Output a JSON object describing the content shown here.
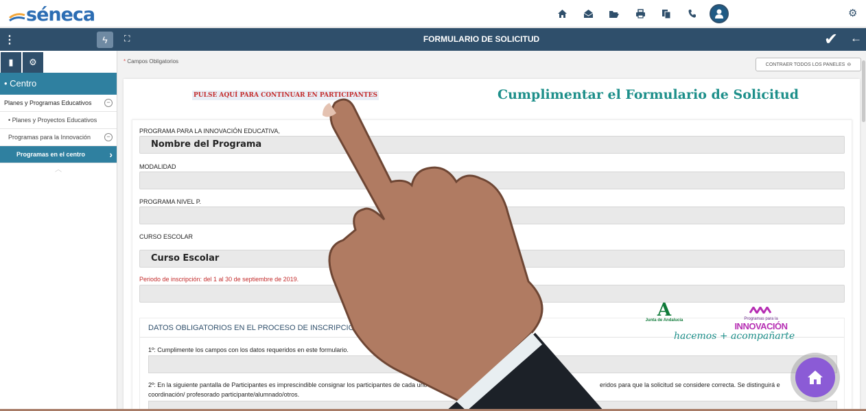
{
  "app": {
    "logo_text": "séneca",
    "brand_color": "#2c6db3",
    "header_color": "#2f4f6b",
    "accent_color": "#2f80a0"
  },
  "topbar": {
    "icons": [
      "home-icon",
      "mail-open-icon",
      "folder-open-icon",
      "print-icon",
      "copy-icon",
      "phone-icon"
    ],
    "user_icon": "user-icon",
    "settings_icon": "gear-icon"
  },
  "sidebar": {
    "centro_label": "• Centro",
    "items": [
      {
        "label": "Planes y Programas Educativos",
        "expanded": true
      },
      {
        "label": "• Planes y Proyectos Educativos"
      },
      {
        "label": "Programas para la Innovación",
        "expanded": true
      },
      {
        "label": "Programas en el centro",
        "active": true
      }
    ]
  },
  "main_header": {
    "title": "FORMULARIO DE SOLICITUD"
  },
  "content": {
    "required_note": "Campos Obligatorios",
    "required_star": "*",
    "collapse_button": "CONTRAER TODOS LOS PANELES",
    "pulse_link": "PULSE AQUÍ PARA CONTINUAR EN PARTICIPANTES",
    "heading": "Cumplimentar el Formulario de Solicitud",
    "fields": [
      {
        "label": "PROGRAMA PARA LA INNOVACIÓN EDUCATIVA,",
        "value": "Nombre del Programa"
      },
      {
        "label": "MODALIDAD",
        "value": ""
      },
      {
        "label": "PROGRAMA NIVEL P.",
        "value": ""
      },
      {
        "label": "CURSO ESCOLAR",
        "value": "Curso Escolar"
      }
    ],
    "period_text": "Periodo de inscripción: del 1 al 30 de septiembre de 2019.",
    "datos": {
      "title": "DATOS OBLIGATORIOS EN EL PROCESO DE INSCRIPCIÓN",
      "line1": "1º: Cumplimente los campos con los datos requeridos en este formulario.",
      "line2a": "2º: En la siguiente pantalla de Participantes es imprescindible consignar los participantes de cada uno",
      "line2b": "eridos para que la solicitud se considere correcta. Se distinguirá e",
      "line3": "coordinación/ profesorado participante/alumnado/otros."
    },
    "logos": {
      "junta_mark": "A",
      "junta_text": "Junta de Andalucía",
      "innov_small": "Programas para la",
      "innov_big": "INNOVACIÓN",
      "slogan": "hacemos + acompañarte"
    }
  }
}
